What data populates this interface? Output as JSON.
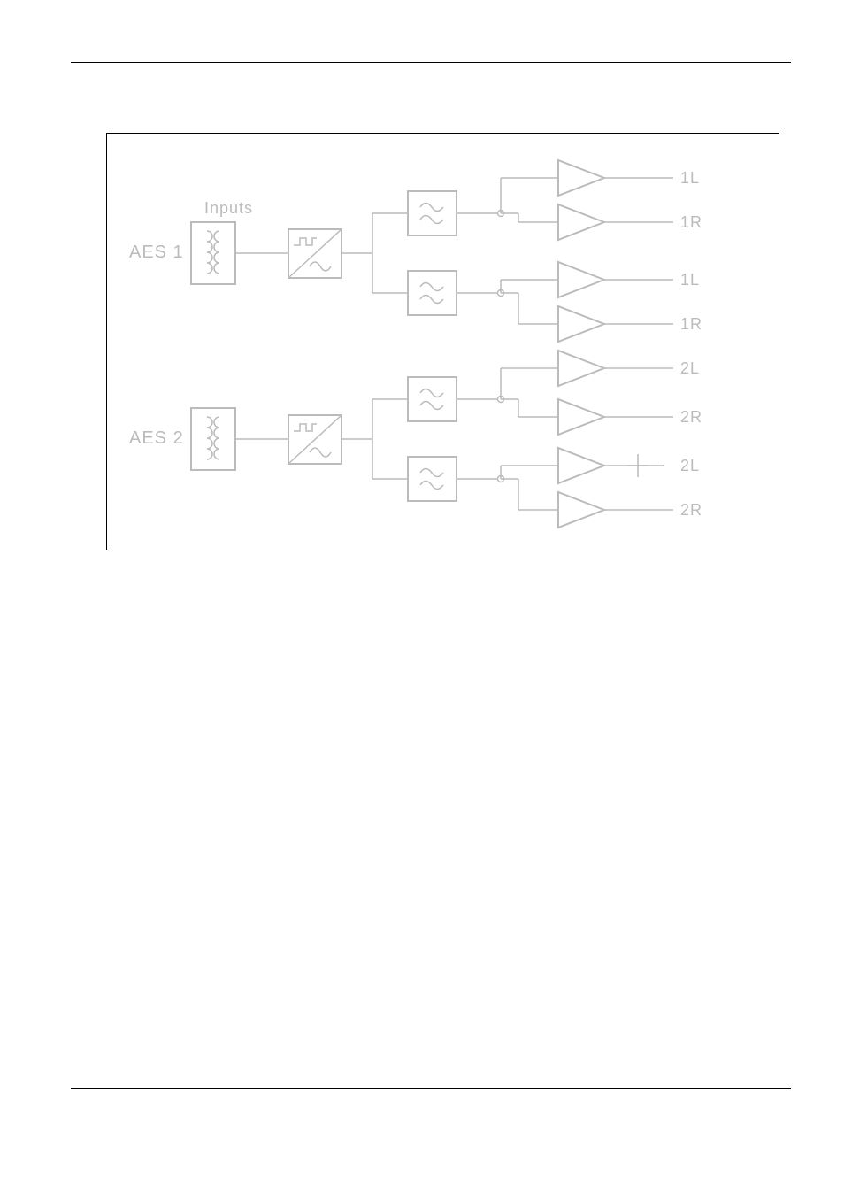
{
  "header": {
    "inputs_label": "Inputs"
  },
  "channels": [
    {
      "input_label": "AES 1",
      "outputs": [
        "1L",
        "1R",
        "1L",
        "1R"
      ]
    },
    {
      "input_label": "AES 2",
      "outputs": [
        "2L",
        "2R",
        "2L",
        "2R"
      ]
    }
  ],
  "icons": {
    "transformer": "transformer-icon",
    "dac": "dac-icon",
    "filter": "filter-icon",
    "amp": "amp-icon"
  }
}
